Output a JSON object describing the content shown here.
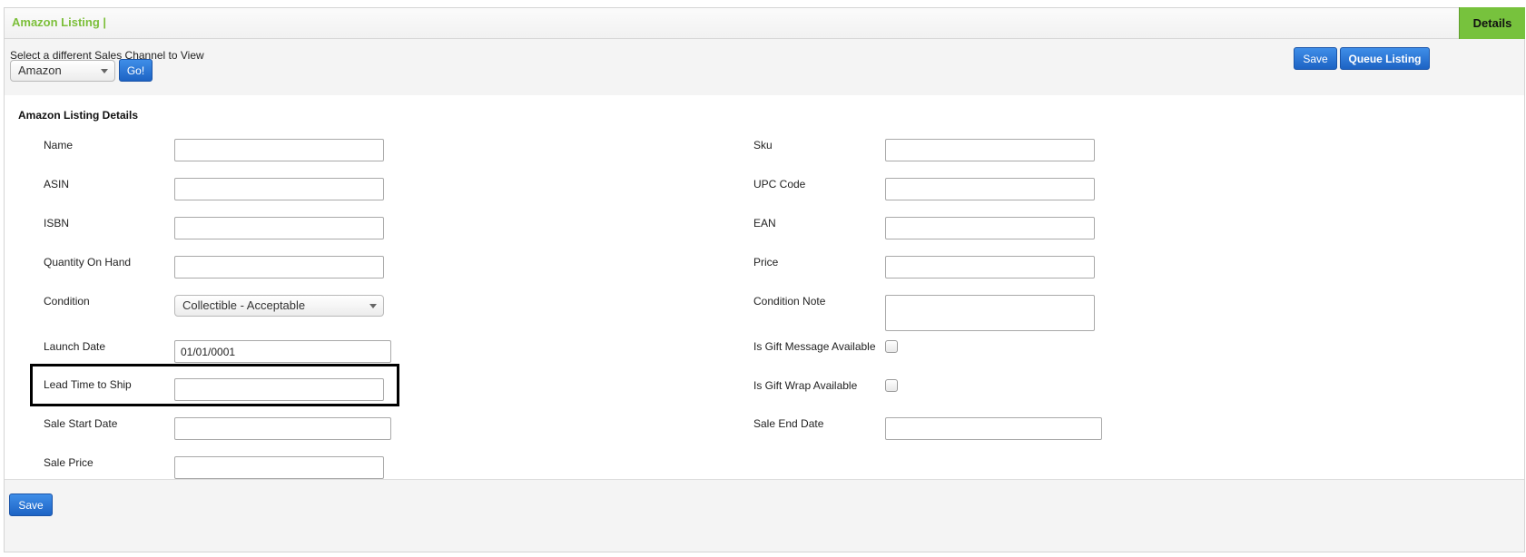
{
  "header": {
    "title": "Amazon Listing |",
    "tab": "Details"
  },
  "toolbar": {
    "select_label": "Select a different Sales Channel to View",
    "channel_value": "Amazon",
    "go_label": "Go!",
    "save_label": "Save",
    "queue_label": "Queue Listing"
  },
  "section": {
    "title": "Amazon Listing Details"
  },
  "left_fields": {
    "name": {
      "label": "Name",
      "value": ""
    },
    "asin": {
      "label": "ASIN",
      "value": ""
    },
    "isbn": {
      "label": "ISBN",
      "value": ""
    },
    "quantity": {
      "label": "Quantity On Hand",
      "value": ""
    },
    "condition": {
      "label": "Condition",
      "value": "Collectible - Acceptable"
    },
    "launch_date": {
      "label": "Launch Date",
      "value": "01/01/0001"
    },
    "lead_time": {
      "label": "Lead Time to Ship",
      "value": ""
    },
    "sale_start": {
      "label": "Sale Start Date",
      "value": ""
    },
    "sale_price": {
      "label": "Sale Price",
      "value": ""
    }
  },
  "right_fields": {
    "sku": {
      "label": "Sku",
      "value": ""
    },
    "upc": {
      "label": "UPC Code",
      "value": ""
    },
    "ean": {
      "label": "EAN",
      "value": ""
    },
    "price": {
      "label": "Price",
      "value": ""
    },
    "condition_note": {
      "label": "Condition Note",
      "value": ""
    },
    "gift_message": {
      "label": "Is Gift Message Available",
      "checked": false
    },
    "gift_wrap": {
      "label": "Is Gift Wrap Available",
      "checked": false
    },
    "sale_end": {
      "label": "Sale End Date",
      "value": ""
    }
  },
  "footer": {
    "save_label": "Save"
  },
  "colors": {
    "brand_green": "#7cbf3a",
    "tab_green": "#77c23d",
    "button_blue": "#1d63c4",
    "highlight": "#000000"
  }
}
